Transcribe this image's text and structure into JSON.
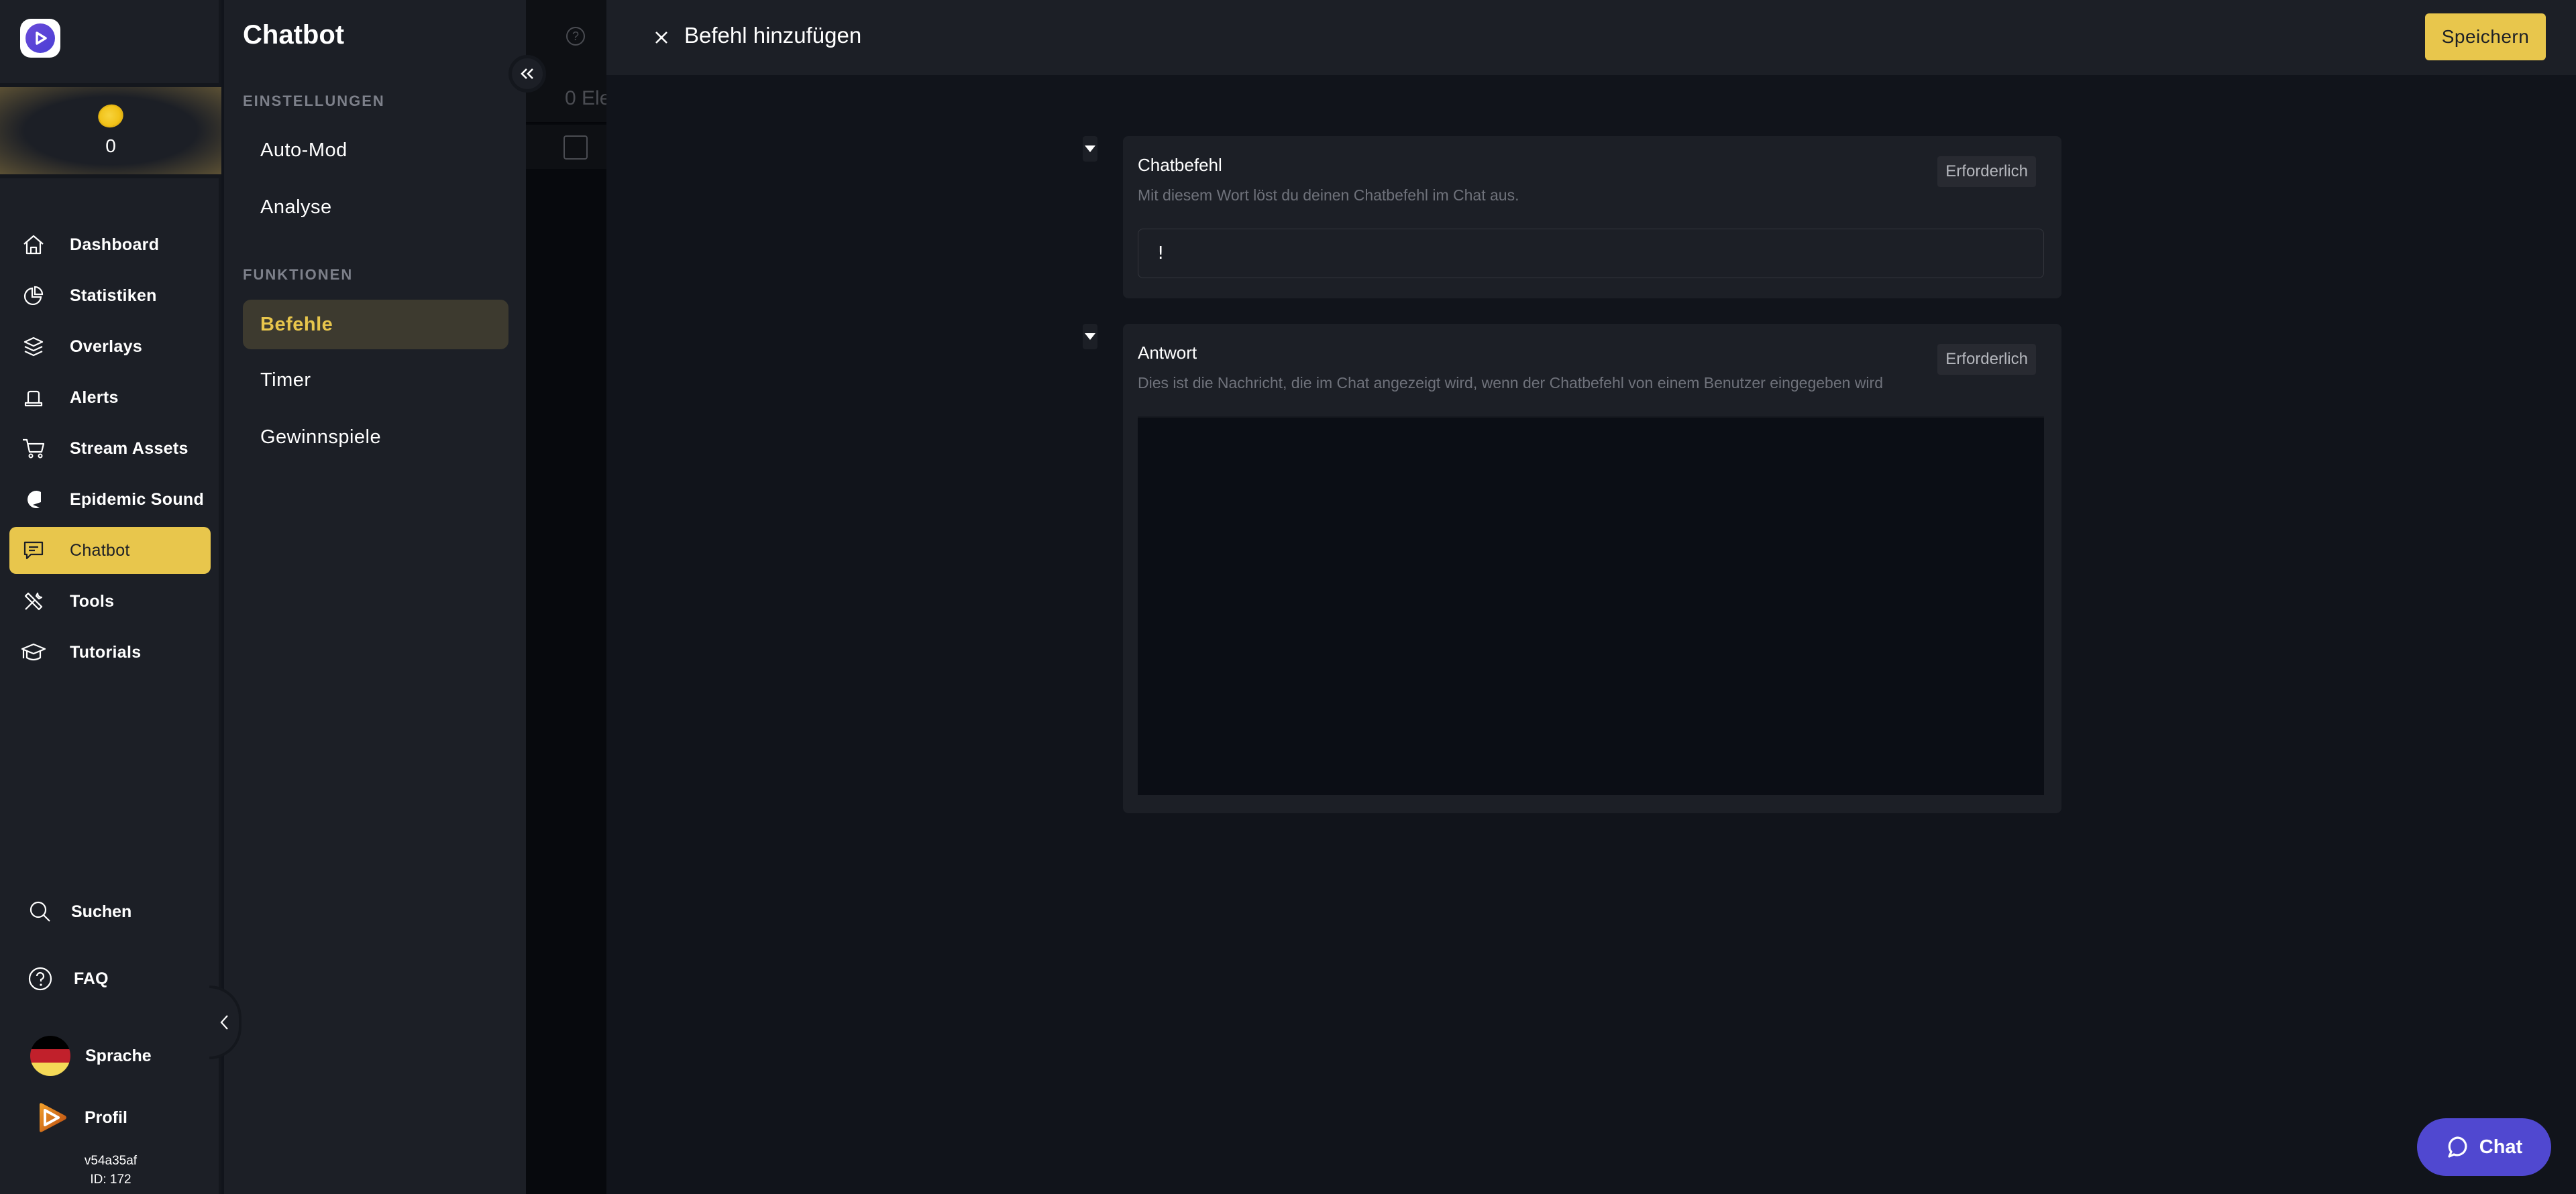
{
  "rail": {
    "coins": "0",
    "nav": [
      {
        "label": "Dashboard",
        "icon": "home-icon"
      },
      {
        "label": "Statistiken",
        "icon": "pie-chart-icon"
      },
      {
        "label": "Overlays",
        "icon": "layers-icon"
      },
      {
        "label": "Alerts",
        "icon": "alert-bell-icon"
      },
      {
        "label": "Stream Assets",
        "icon": "cart-icon"
      },
      {
        "label": "Epidemic Sound",
        "icon": "epidemic-sound-icon"
      },
      {
        "label": "Chatbot",
        "icon": "chat-message-icon",
        "active": true
      },
      {
        "label": "Tools",
        "icon": "tools-icon"
      },
      {
        "label": "Tutorials",
        "icon": "graduation-cap-icon"
      }
    ],
    "bottom": {
      "search": "Suchen",
      "faq": "FAQ",
      "language": "Sprache",
      "profile": "Profil"
    },
    "version": "v54a35af",
    "user_id": "ID: 172"
  },
  "subnav": {
    "title": "Chatbot",
    "sections": [
      {
        "title": "EINSTELLUNGEN",
        "items": [
          "Auto-Mod",
          "Analyse"
        ]
      },
      {
        "title": "FUNKTIONEN",
        "items": [
          "Befehle",
          "Timer",
          "Gewinnspiele"
        ]
      }
    ],
    "active_item": "Befehle"
  },
  "background": {
    "count_text": "0 Ele",
    "help_glyph": "?"
  },
  "panel": {
    "title": "Befehl hinzufügen",
    "save_label": "Speichern",
    "fields": [
      {
        "label": "Chatbefehl",
        "description": "Mit diesem Wort löst du deinen Chatbefehl im Chat aus.",
        "badge": "Erforderlich",
        "value": "!"
      },
      {
        "label": "Antwort",
        "description": "Dies ist die Nachricht, die im Chat angezeigt wird, wenn der Chatbefehl von einem Benutzer eingegeben wird",
        "badge": "Erforderlich",
        "value": ""
      }
    ]
  },
  "chat_widget": {
    "label": "Chat"
  },
  "colors": {
    "accent": "#e8c64c",
    "accent_dim": "#3d3a2f",
    "chat_button": "#5048d0",
    "surface": "#1c1f26",
    "background": "#11141b"
  }
}
